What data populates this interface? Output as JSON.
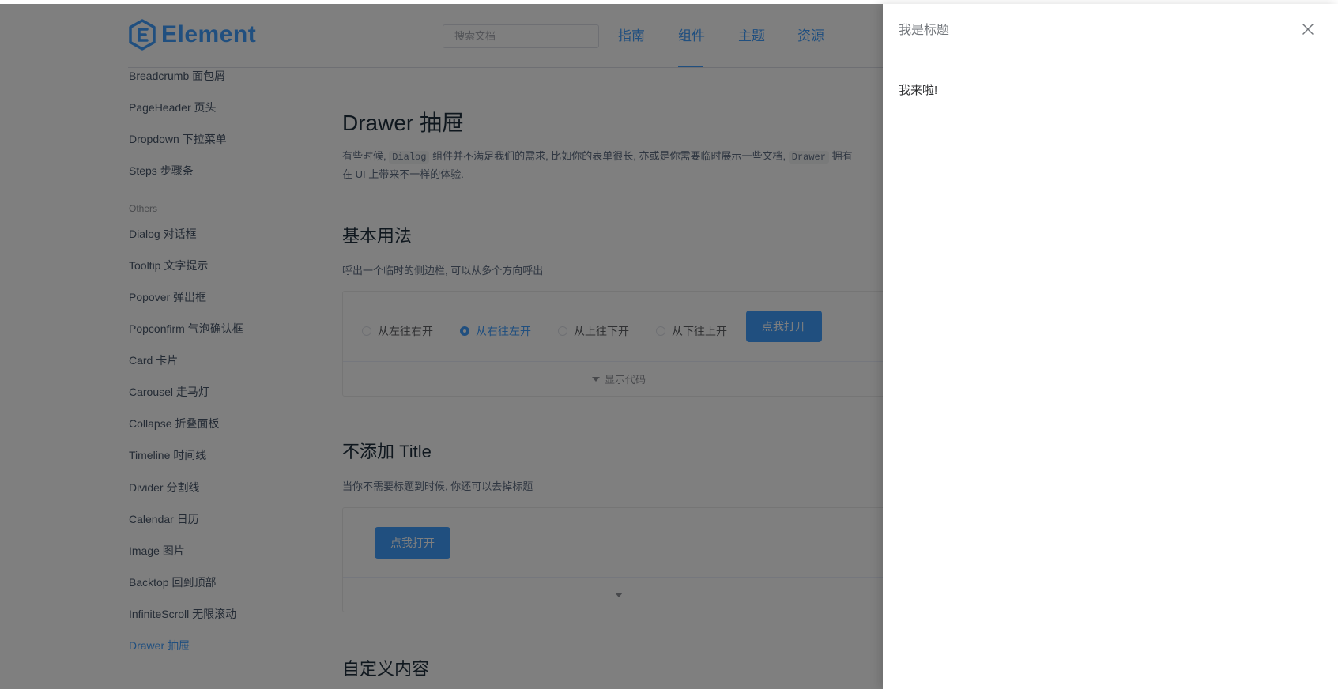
{
  "header": {
    "logo_text": "Element",
    "search_placeholder": "搜索文档",
    "nav": [
      "指南",
      "组件",
      "主题",
      "资源"
    ],
    "active_nav_index": 1
  },
  "sidebar": {
    "items_top": [
      "Breadcrumb 面包屑",
      "PageHeader 页头",
      "Dropdown 下拉菜单",
      "Steps 步骤条"
    ],
    "group_label": "Others",
    "items": [
      "Dialog 对话框",
      "Tooltip 文字提示",
      "Popover 弹出框",
      "Popconfirm 气泡确认框",
      "Card 卡片",
      "Carousel 走马灯",
      "Collapse 折叠面板",
      "Timeline 时间线",
      "Divider 分割线",
      "Calendar 日历",
      "Image 图片",
      "Backtop 回到顶部",
      "InfiniteScroll 无限滚动",
      "Drawer 抽屉"
    ],
    "active_item": "Drawer 抽屉"
  },
  "content": {
    "title": "Drawer 抽屉",
    "desc_part1": "有些时候, ",
    "desc_code1": "Dialog",
    "desc_part2": " 组件并不满足我们的需求, 比如你的表单很长, 亦或是你需要临时展示一些文档, ",
    "desc_code2": "Drawer",
    "desc_part3": " 拥有",
    "desc_line2": "在 UI 上带来不一样的体验.",
    "basic": {
      "heading": "基本用法",
      "desc": "呼出一个临时的侧边栏, 可以从多个方向呼出",
      "radios": [
        "从左往右开",
        "从右往左开",
        "从上往下开",
        "从下往上开"
      ],
      "selected_radio_index": 1,
      "open_button": "点我打开",
      "show_code": "显示代码"
    },
    "no_title": {
      "heading": "不添加 Title",
      "desc": "当你不需要标题到时候, 你还可以去掉标题",
      "open_button": "点我打开"
    },
    "custom": {
      "heading": "自定义内容"
    }
  },
  "drawer": {
    "title": "我是标题",
    "body": "我来啦!"
  },
  "colors": {
    "primary": "#409eff",
    "overlay": "rgba(0,0,0,0.5)"
  }
}
